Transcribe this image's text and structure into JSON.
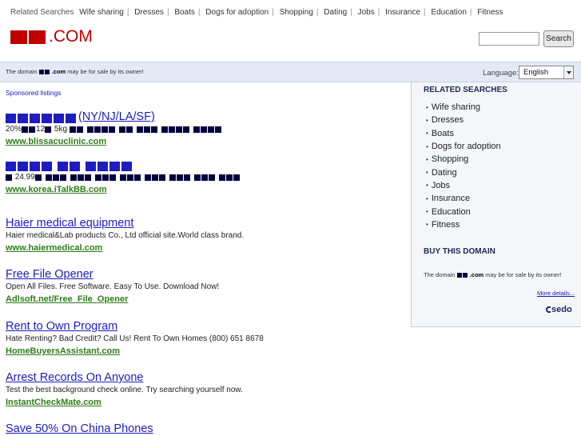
{
  "top_related": {
    "label": "Related Searches",
    "items": [
      "Wife sharing",
      "Dresses",
      "Boats",
      "Dogs for adoption",
      "Shopping",
      "Dating",
      "Jobs",
      "Insurance",
      "Education",
      "Fitness"
    ]
  },
  "logo": {
    "suffix": ".COM"
  },
  "search": {
    "value": "",
    "button": "Search"
  },
  "notice": {
    "prefix": "The domain",
    "domain": ".com",
    "suffix": "may be for sale by its owner!"
  },
  "language": {
    "label": "Language:",
    "selected": "English"
  },
  "sponsored_label": "Sponsored listings",
  "listings": [
    {
      "title_suffix": "(NY/NJ/LA/SF)",
      "desc_prefix": "20%",
      "desc_mid": "12",
      "desc_after": "5kg",
      "url": "www.blissacuclinic.com"
    },
    {
      "desc_mid": "24.99",
      "url": "www.korea.iTalkBB.com"
    },
    {
      "title": "Haier medical equipment",
      "desc": "Haier medical&Lab products Co., Ltd official site.World class brand.",
      "url": "www.haiermedical.com"
    },
    {
      "title": "Free File Opener",
      "desc": "Open All Files. Free Software. Easy To Use. Download Now!",
      "url": "Adlsoft.net/Free_File_Opener"
    },
    {
      "title": "Rent to Own Program",
      "desc": "Hate Renting? Bad Credit? Call Us! Rent To Own Homes (800) 651 8678",
      "url": "HomeBuyersAssistant.com"
    },
    {
      "title": "Arrest Records On Anyone",
      "desc": "Test the best background check online. Try searching yourself now.",
      "url": "InstantCheckMate.com"
    },
    {
      "title": "Save 50% On China Phones"
    }
  ],
  "sidebar": {
    "related_heading": "RELATED SEARCHES",
    "related_items": [
      "Wife sharing",
      "Dresses",
      "Boats",
      "Dogs for adoption",
      "Shopping",
      "Dating",
      "Jobs",
      "Insurance",
      "Education",
      "Fitness"
    ],
    "buy_heading": "BUY THIS DOMAIN",
    "buy_prefix": "The domain",
    "buy_domain": ".com",
    "buy_suffix": "may be for sale by its owner!",
    "more_details": "More details...",
    "brand": "sedo"
  },
  "colors": {
    "brand_red": "#c00000",
    "link_blue": "#1c1cbf",
    "url_green": "#2f7d1b",
    "notice_bg": "#e3eaf5"
  },
  "icons": {
    "sedo_logo": "sedo-logo-icon",
    "select_arrow": "chevron-down-icon"
  }
}
